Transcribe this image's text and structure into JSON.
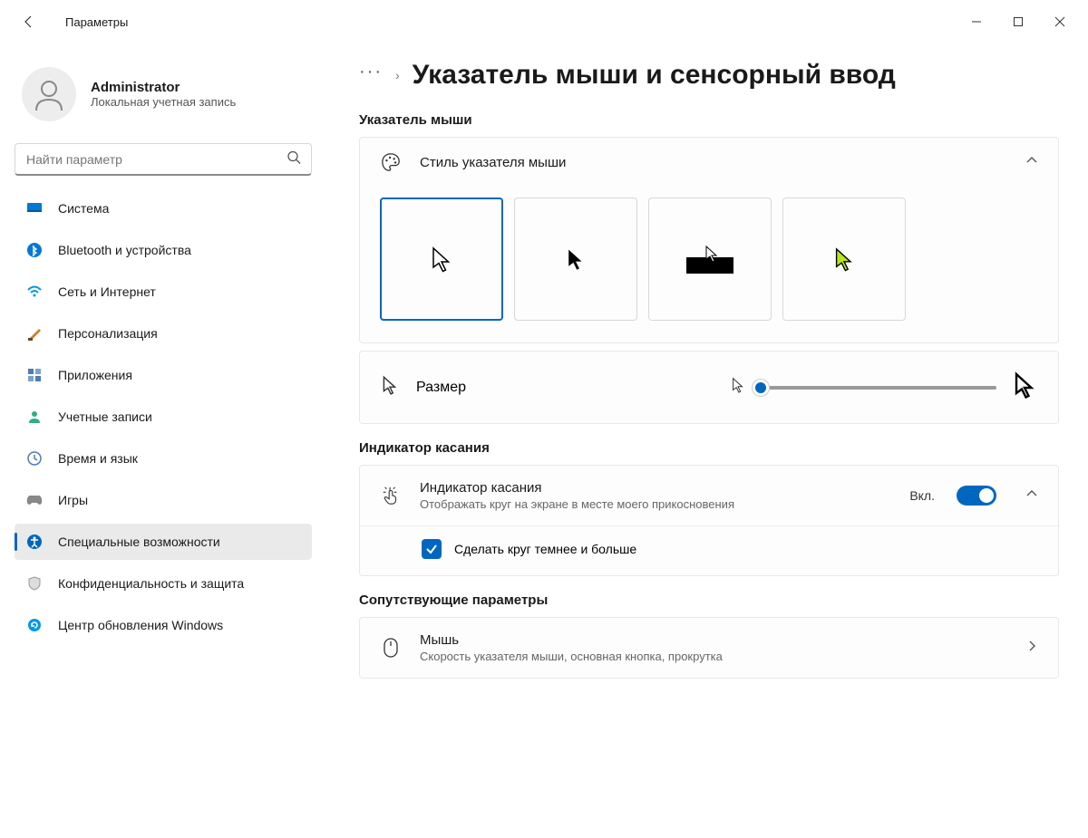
{
  "titlebar": {
    "title": "Параметры"
  },
  "account": {
    "name": "Administrator",
    "sub": "Локальная учетная запись"
  },
  "search": {
    "placeholder": "Найти параметр"
  },
  "nav": [
    {
      "label": "Система",
      "icon": "monitor"
    },
    {
      "label": "Bluetooth и устройства",
      "icon": "bluetooth"
    },
    {
      "label": "Сеть и Интернет",
      "icon": "wifi"
    },
    {
      "label": "Персонализация",
      "icon": "brush"
    },
    {
      "label": "Приложения",
      "icon": "apps"
    },
    {
      "label": "Учетные записи",
      "icon": "person"
    },
    {
      "label": "Время и язык",
      "icon": "time"
    },
    {
      "label": "Игры",
      "icon": "games"
    },
    {
      "label": "Специальные возможности",
      "icon": "accessibility",
      "active": true
    },
    {
      "label": "Конфиденциальность и защита",
      "icon": "shield"
    },
    {
      "label": "Центр обновления Windows",
      "icon": "update"
    }
  ],
  "breadcrumb": {
    "title": "Указатель мыши и сенсорный ввод"
  },
  "sections": {
    "pointer": {
      "title": "Указатель мыши"
    },
    "touch": {
      "title": "Индикатор касания"
    },
    "related": {
      "title": "Сопутствующие параметры"
    }
  },
  "pointerStyle": {
    "title": "Стиль указателя мыши"
  },
  "size": {
    "title": "Размер"
  },
  "touchIndicator": {
    "title": "Индикатор касания",
    "sub": "Отображать круг на экране в месте моего прикосновения",
    "state": "Вкл.",
    "checkbox_label": "Сделать круг темнее и больше"
  },
  "mouse": {
    "title": "Мышь",
    "sub": "Скорость указателя мыши, основная кнопка, прокрутка"
  }
}
